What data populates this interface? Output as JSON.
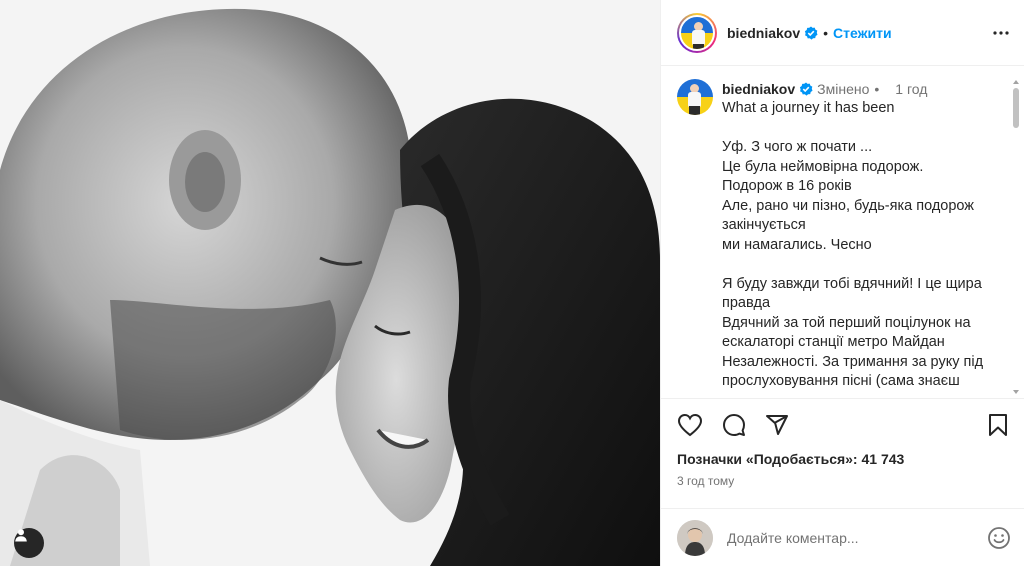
{
  "post": {
    "photo_alt": "",
    "user_tag_icon": "user-icon"
  },
  "header": {
    "username": "biedniakov",
    "separator": "•",
    "follow_label": "Стежити",
    "more_icon": "more-horizontal-icon"
  },
  "caption": {
    "username": "biedniakov",
    "edited": "Змінено",
    "separator": "•",
    "time": "1 год",
    "text": "What a journey it has been\n\nУф. З чого ж почати ...\nЦе була неймовірна подорож.\nПодорож в 16 років\nАле, рано чи пізно, будь-яка подорож закінчується\nми намагались. Чесно\n\nЯ буду завжди тобі вдячний! І це щира правда\nВдячний за той перший поцілунок на ескалаторі станції метро Майдан Незалежності. За тримання за руку під прослуховування пісні (сама знаєш"
  },
  "actions": {
    "like_icon": "heart-icon",
    "comment_icon": "comment-icon",
    "share_icon": "send-icon",
    "save_icon": "bookmark-icon",
    "likes_label": "Позначки «Подобається»: 41 743",
    "date": "3 год тому"
  },
  "comment_box": {
    "placeholder": "Додайте коментар...",
    "emoji_icon": "smiley-icon"
  },
  "colors": {
    "accent": "#0095f6",
    "verified": "#0095f6",
    "text": "#262626",
    "muted": "#737373"
  }
}
